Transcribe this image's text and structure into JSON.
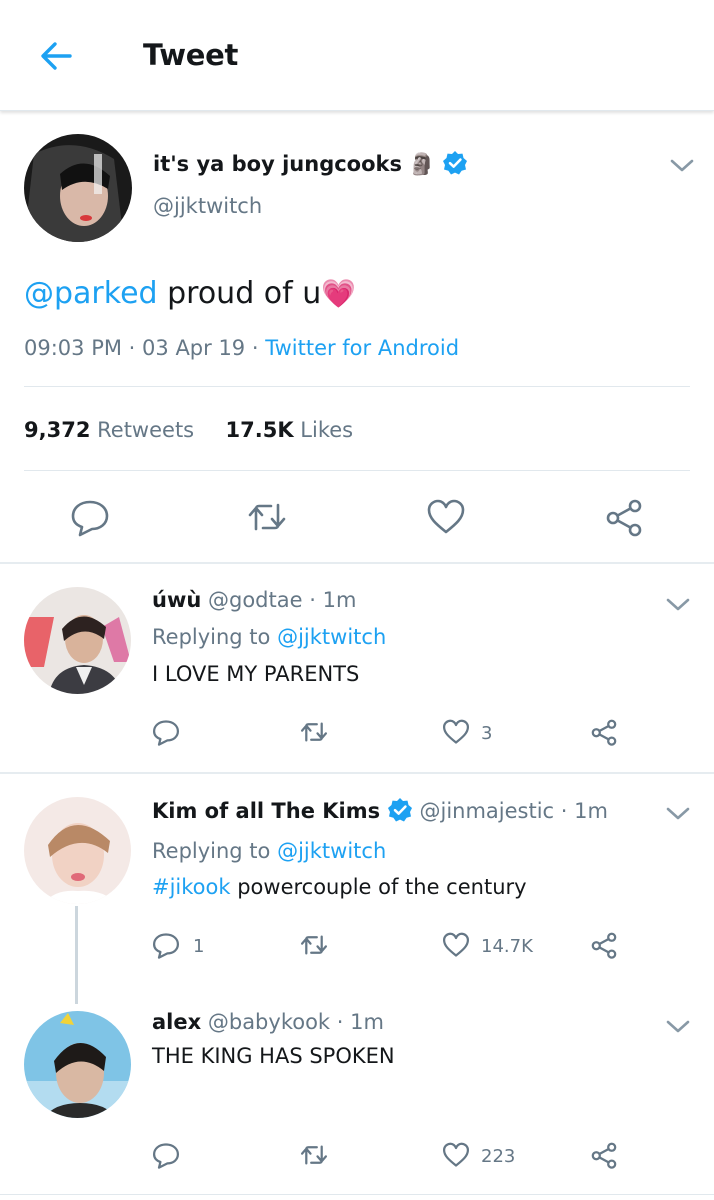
{
  "header": {
    "title": "Tweet"
  },
  "tweet": {
    "name": "it's ya boy jungcooks",
    "name_emoji": "🗿",
    "handle": "@jjktwitch",
    "mention": "@parked",
    "text": " proud of u",
    "heart_emoji": "💗",
    "time": "09:03 PM",
    "date": "03 Apr 19",
    "client": "Twitter for Android",
    "retweets_count": "9,372",
    "retweets_label": "Retweets",
    "likes_count": "17.5K",
    "likes_label": "Likes"
  },
  "replies": [
    {
      "name": "úwù",
      "handle": "@godtae",
      "time": "1m",
      "replying_prefix": "Replying to",
      "replying_to": "@jjktwitch",
      "text": "I LOVE MY PARENTS",
      "replies": "",
      "likes": "3"
    },
    {
      "name": "Kim of all The Kims",
      "handle": "@jinmajestic",
      "time": "1m",
      "replying_prefix": "Replying to",
      "replying_to": "@jjktwitch",
      "hashtag": "#jikook",
      "text": " powercouple of the century",
      "replies": "1",
      "likes": "14.7K"
    },
    {
      "name": "alex",
      "handle": "@babykook",
      "time": "1m",
      "text": "THE KING HAS SPOKEN",
      "replies": "",
      "likes": "223"
    }
  ],
  "separator": "·",
  "colors": {
    "accent": "#1da1f2",
    "muted": "#657786",
    "divider": "#e1e8ed"
  }
}
